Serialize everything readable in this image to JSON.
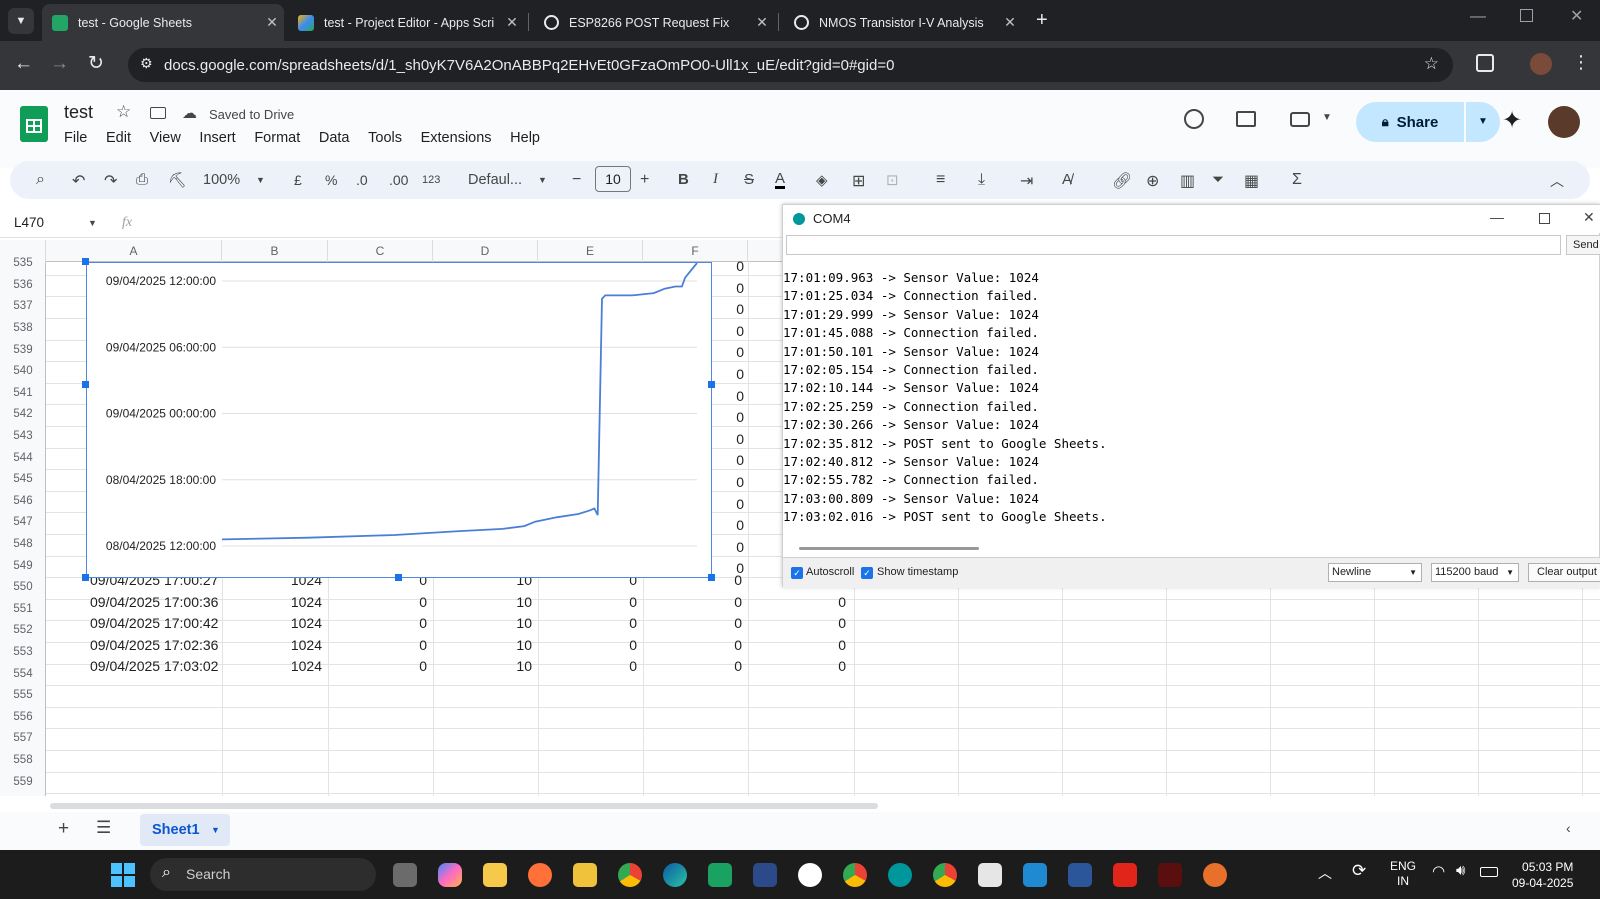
{
  "browser": {
    "tabs": [
      {
        "title": "test - Google Sheets",
        "active": true
      },
      {
        "title": "test - Project Editor - Apps Scri"
      },
      {
        "title": "ESP8266 POST Request Fix"
      },
      {
        "title": "NMOS Transistor I-V Analysis"
      }
    ],
    "url": "docs.google.com/spreadsheets/d/1_sh0yK7V6A2OnABBPq2EHvEt0GFzaOmPO0-Ull1x_uE/edit?gid=0#gid=0"
  },
  "doc": {
    "title": "test",
    "saved_status": "Saved to Drive",
    "menu": [
      "File",
      "Edit",
      "View",
      "Insert",
      "Format",
      "Data",
      "Tools",
      "Extensions",
      "Help"
    ],
    "share_label": "Share"
  },
  "toolbar": {
    "zoom": "100%",
    "currency": "£",
    "percent": "%",
    "dec_less": ".0",
    "dec_more": ".00",
    "number_format": "123",
    "font": "Defaul...",
    "font_size": "10",
    "bold": "B",
    "italic": "I",
    "strike": "S",
    "text_color": "A"
  },
  "formula": {
    "cell_ref": "L470",
    "fx": "fx"
  },
  "columns": [
    "A",
    "B",
    "C",
    "D",
    "E",
    "F"
  ],
  "row_numbers": [
    "535",
    "536",
    "537",
    "538",
    "539",
    "540",
    "541",
    "542",
    "543",
    "544",
    "545",
    "546",
    "547",
    "548",
    "549",
    "550",
    "551",
    "552",
    "553",
    "554",
    "555",
    "556",
    "557",
    "558",
    "559"
  ],
  "rows": [
    {
      "a": "09/04/2025 17:00:27",
      "b": "1024",
      "c": "0",
      "d": "10",
      "e": "0",
      "f": "0",
      "g": "0"
    },
    {
      "a": "09/04/2025 17:00:36",
      "b": "1024",
      "c": "0",
      "d": "10",
      "e": "0",
      "f": "0",
      "g": "0"
    },
    {
      "a": "09/04/2025 17:00:42",
      "b": "1024",
      "c": "0",
      "d": "10",
      "e": "0",
      "f": "0",
      "g": "0"
    },
    {
      "a": "09/04/2025 17:02:36",
      "b": "1024",
      "c": "0",
      "d": "10",
      "e": "0",
      "f": "0",
      "g": "0"
    },
    {
      "a": "09/04/2025 17:03:02",
      "b": "1024",
      "c": "0",
      "d": "10",
      "e": "0",
      "f": "0",
      "g": "0"
    }
  ],
  "f_col_upper": [
    "0",
    "0",
    "0",
    "0",
    "0",
    "0",
    "0",
    "0",
    "0",
    "0",
    "0",
    "0",
    "0",
    "0",
    "0"
  ],
  "chart_data": {
    "type": "line",
    "y_ticks": [
      "09/04/2025 12:00:00",
      "09/04/2025 06:00:00",
      "09/04/2025 00:00:00",
      "08/04/2025 18:00:00",
      "08/04/2025 12:00:00"
    ],
    "y_hours": [
      24,
      18,
      12,
      6,
      0
    ],
    "series": [
      {
        "points": [
          [
            0,
            0.6
          ],
          [
            8,
            0.75
          ],
          [
            16,
            1.0
          ],
          [
            22,
            1.35
          ],
          [
            26,
            1.55
          ],
          [
            28,
            1.8
          ],
          [
            29,
            2.2
          ],
          [
            31,
            2.6
          ],
          [
            33,
            2.9
          ],
          [
            34,
            3.2
          ],
          [
            34.5,
            3.4
          ],
          [
            34.8,
            2.8
          ],
          [
            35.2,
            22.4
          ],
          [
            35.5,
            22.7
          ],
          [
            38,
            22.7
          ],
          [
            40,
            22.9
          ],
          [
            41,
            23.3
          ],
          [
            42,
            23.5
          ],
          [
            42.6,
            23.5
          ],
          [
            42.9,
            24.3
          ],
          [
            44,
            26
          ]
        ]
      }
    ],
    "color": "#4a7fd6"
  },
  "serial": {
    "title": "COM4",
    "send_label": "Send",
    "lines": [
      "17:01:09.963 -> Sensor Value: 1024",
      "17:01:25.034 -> Connection failed.",
      "17:01:29.999 -> Sensor Value: 1024",
      "17:01:45.088 -> Connection failed.",
      "17:01:50.101 -> Sensor Value: 1024",
      "17:02:05.154 -> Connection failed.",
      "17:02:10.144 -> Sensor Value: 1024",
      "17:02:25.259 -> Connection failed.",
      "17:02:30.266 -> Sensor Value: 1024",
      "17:02:35.812 -> POST sent to Google Sheets.",
      "17:02:40.812 -> Sensor Value: 1024",
      "17:02:55.782 -> Connection failed.",
      "17:03:00.809 -> Sensor Value: 1024",
      "17:03:02.016 -> POST sent to Google Sheets."
    ],
    "autoscroll_label": "Autoscroll",
    "timestamp_label": "Show timestamp",
    "line_ending": "Newline",
    "baud": "115200 baud",
    "clear_label": "Clear output"
  },
  "sheet_tab": "Sheet1",
  "taskbar": {
    "search_label": "Search",
    "lang1": "ENG",
    "lang2": "IN",
    "time": "05:03 PM",
    "date": "09-04-2025"
  }
}
